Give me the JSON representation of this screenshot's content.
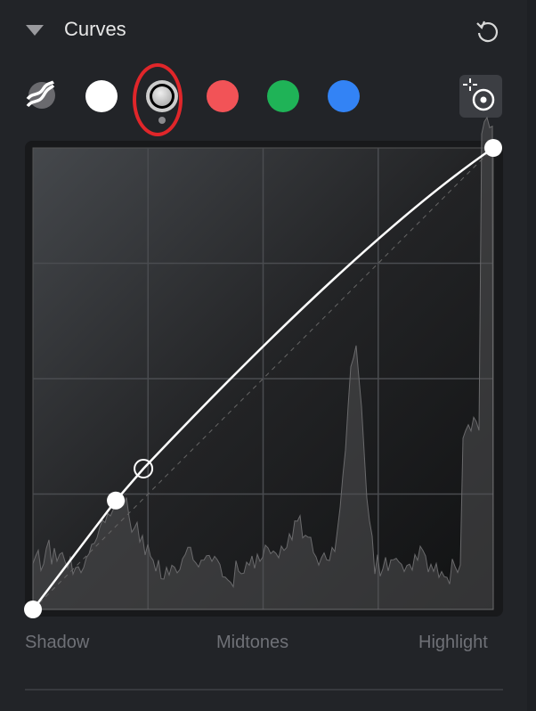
{
  "header": {
    "title": "Curves",
    "collapse_icon": "triangle-down-icon",
    "reset_icon": "reset-icon"
  },
  "channels": [
    {
      "name": "auto",
      "icon": "auto-curves-icon"
    },
    {
      "name": "rgb",
      "color": "#ffffff"
    },
    {
      "name": "luminance",
      "color": "#c0c0c0",
      "selected": true
    },
    {
      "name": "red",
      "color": "#f25357"
    },
    {
      "name": "green",
      "color": "#1fb357"
    },
    {
      "name": "blue",
      "color": "#3383f5"
    }
  ],
  "highlight_color": "#e0262a",
  "picker_icon": "target-picker-icon",
  "curve": {
    "points": [
      [
        0,
        0
      ],
      [
        0.18,
        0.236
      ],
      [
        0.24,
        0.305
      ],
      [
        1,
        1
      ]
    ],
    "hollow_point": [
      0.24,
      0.305
    ]
  },
  "axis_labels": {
    "shadow": "Shadow",
    "midtones": "Midtones",
    "highlight": "Highlight"
  }
}
